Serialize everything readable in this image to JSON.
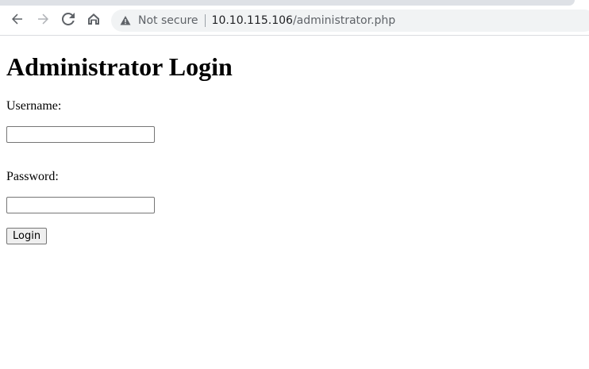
{
  "browser": {
    "security_label": "Not secure",
    "url_host": "10.10.115.106",
    "url_path": "/administrator.php",
    "icons": [
      "back-arrow-icon",
      "forward-arrow-icon",
      "reload-icon",
      "home-icon",
      "warning-icon"
    ]
  },
  "page": {
    "heading": "Administrator Login",
    "username_label": "Username:",
    "username_value": "",
    "password_label": "Password:",
    "password_value": "",
    "submit_label": "Login"
  }
}
